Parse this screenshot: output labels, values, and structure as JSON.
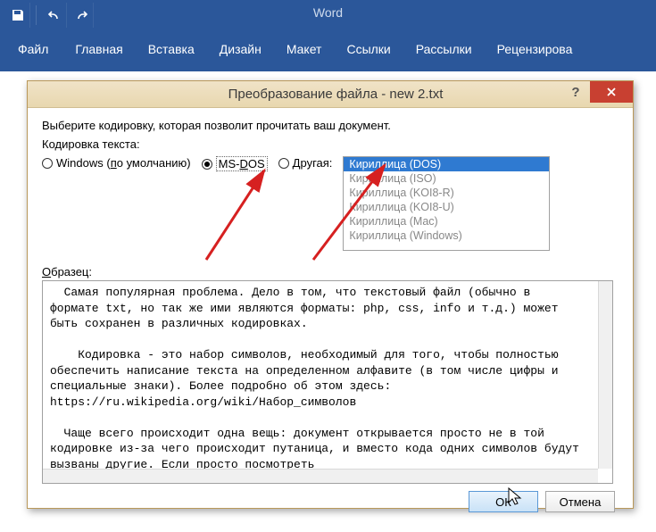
{
  "app": {
    "title": "Word"
  },
  "quickaccess": {
    "save": "save-icon",
    "undo": "undo-icon",
    "redo": "redo-icon"
  },
  "ribbon": {
    "file": "Файл",
    "home": "Главная",
    "insert": "Вставка",
    "design": "Дизайн",
    "layout": "Макет",
    "references": "Ссылки",
    "mailings": "Рассылки",
    "review": "Рецензирова"
  },
  "dialog": {
    "title": "Преобразование файла - new 2.txt",
    "instruction": "Выберите кодировку, которая позволит прочитать ваш документ.",
    "encoding_section": "Кодировка текста:",
    "radios": {
      "windows_pre": "Windows (",
      "windows_u": "п",
      "windows_post": "о умолчанию)",
      "msdos_pre": "MS-",
      "msdos_u": "D",
      "msdos_post": "OS",
      "other_u": "Д",
      "other_post": "ругая:"
    },
    "encodings": {
      "i0": "Кириллица (DOS)",
      "i1": "Кириллица (ISO)",
      "i2": "Кириллица (KOI8-R)",
      "i3": "Кириллица (KOI8-U)",
      "i4": "Кириллица (Mac)",
      "i5": "Кириллица (Windows)"
    },
    "sample_label_u": "О",
    "sample_label_post": "бразец:",
    "sample_text": "  Самая популярная проблема. Дело в том, что текстовый файл (обычно в формате txt, но так же ими являются форматы: php, css, info и т.д.) может быть сохранен в различных кодировках.\n\n    Кодировка - это набор символов, необходимый для того, чтобы полностью обеспечить написание текста на определенном алфавите (в том числе цифры и специальные знаки). Более подробно об этом здесь: https://ru.wikipedia.org/wiki/Набор_символов\n\n  Чаще всего происходит одна вещь: документ открывается просто не в той кодировке из-за чего происходит путаница, и вместо кода одних символов будут вызваны другие. Если просто посмотреть",
    "buttons": {
      "ok": "ОК",
      "cancel": "Отмена"
    }
  }
}
